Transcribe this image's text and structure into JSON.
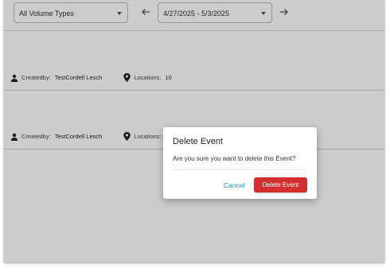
{
  "toolbar": {
    "volume_select": {
      "value": "All Volume Types"
    },
    "date_range": {
      "value": "4/27/2025 - 5/3/2025"
    },
    "prev_icon": "arrow-left-icon",
    "next_icon": "arrow-right-icon"
  },
  "events": [
    {
      "createdby_label": "Createdby:",
      "createdby_value": "TestCordell Lesch",
      "locations_label": "Locations:",
      "locations_value": "10"
    },
    {
      "createdby_label": "Createdby:",
      "createdby_value": "TestCordell Lesch",
      "locations_label": "Locations:",
      "locations_value": ""
    }
  ],
  "dialog": {
    "title": "Delete Event",
    "message": "Are you sure you want to delete this Event?",
    "cancel_label": "Cancel",
    "delete_label": "Delete Event"
  },
  "colors": {
    "danger": "#d32f2f",
    "link": "#1e88c8",
    "overlay": "rgba(0,0,0,0.2)"
  }
}
